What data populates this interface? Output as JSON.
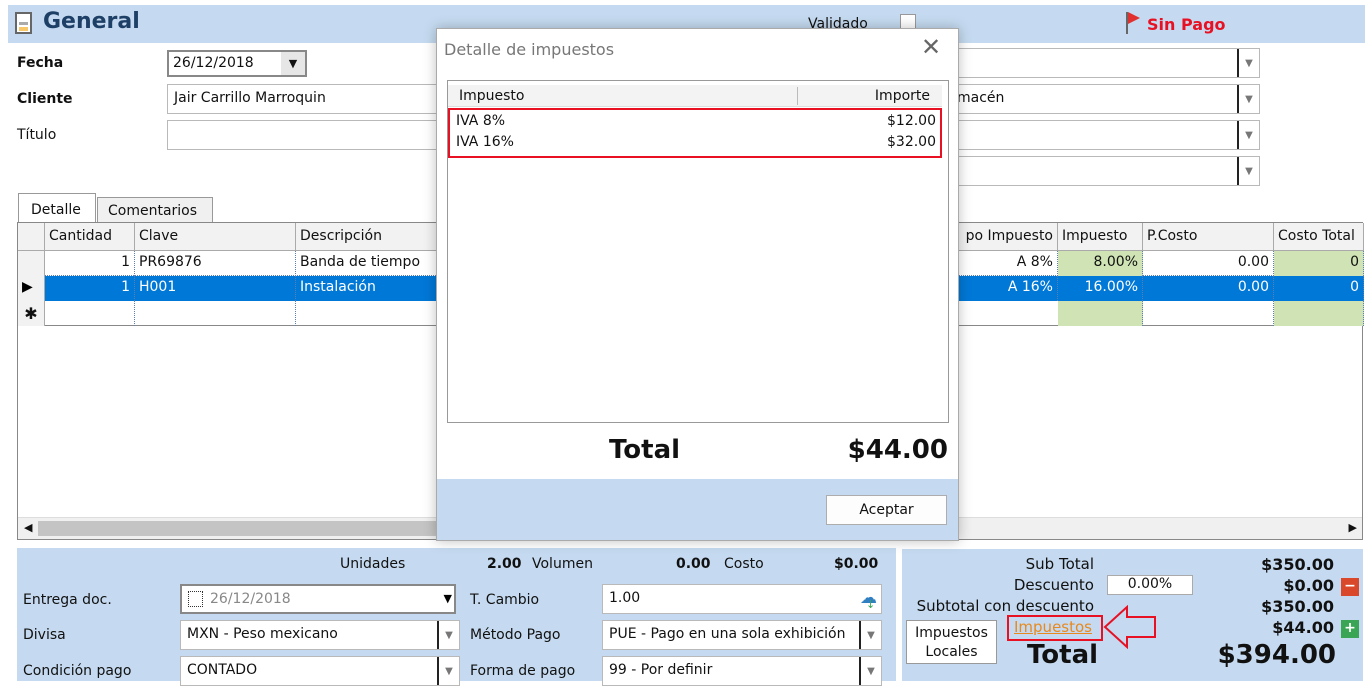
{
  "header": {
    "title": "General",
    "validado_label": "Validado",
    "status": "Sin Pago"
  },
  "form": {
    "fecha_label": "Fecha",
    "fecha_value": "26/12/2018",
    "cliente_label": "Cliente",
    "cliente_value": "Jair Carrillo Marroquin",
    "titulo_label": "Título",
    "titulo_value": "",
    "right_combos": [
      "",
      "macén",
      "",
      ""
    ]
  },
  "tabs": [
    {
      "label": "Detalle"
    },
    {
      "label": "Comentarios"
    }
  ],
  "grid": {
    "columns": [
      "Cantidad",
      "Clave",
      "Descripción",
      "po Impuesto",
      "Impuesto",
      "P.Costo",
      "Costo Total"
    ],
    "rows": [
      {
        "cantidad": "1",
        "clave": "PR69876",
        "descripcion": "Banda de tiempo",
        "tipo": "A 8%",
        "impuesto": "8.00%",
        "pcosto": "0.00",
        "total": "0"
      },
      {
        "cantidad": "1",
        "clave": "H001",
        "descripcion": "Instalación",
        "tipo": "A 16%",
        "impuesto": "16.00%",
        "pcosto": "0.00",
        "total": "0"
      }
    ]
  },
  "dialog": {
    "title": "Detalle de impuestos",
    "col_impuesto": "Impuesto",
    "col_importe": "Importe",
    "rows": [
      {
        "impuesto": "IVA 8%",
        "importe": "$12.00"
      },
      {
        "impuesto": "IVA 16%",
        "importe": "$32.00"
      }
    ],
    "total_label": "Total",
    "total_value": "$44.00",
    "ok_label": "Aceptar"
  },
  "summary": {
    "unidades_label": "Unidades",
    "unidades": "2.00",
    "volumen_label": "Volumen",
    "volumen": "0.00",
    "costo_label": "Costo",
    "costo": "$0.00",
    "entrega_label": "Entrega doc.",
    "entrega_value": "26/12/2018",
    "tcambio_label": "T. Cambio",
    "tcambio_value": "1.00",
    "divisa_label": "Divisa",
    "divisa_value": "MXN - Peso mexicano",
    "metodo_label": "Método Pago",
    "metodo_value": "PUE - Pago en una sola exhibición",
    "condicion_label": "Condición pago",
    "condicion_value": "CONTADO",
    "forma_label": "Forma de pago",
    "forma_value": "99 - Por definir"
  },
  "totals": {
    "subtotal_label": "Sub Total",
    "subtotal": "$350.00",
    "descuento_label": "Descuento",
    "descuento_pct": "0.00%",
    "descuento": "$0.00",
    "subdesc_label": "Subtotal con descuento",
    "subdesc": "$350.00",
    "impuestos_link": "Impuestos",
    "impuestos": "$44.00",
    "locales_label": "Impuestos Locales",
    "total_label": "Total",
    "total": "$394.00"
  },
  "colors": {
    "accent": "#0078d7",
    "panel": "#c5daf0",
    "alert": "#e81123",
    "link": "#e8891d"
  }
}
